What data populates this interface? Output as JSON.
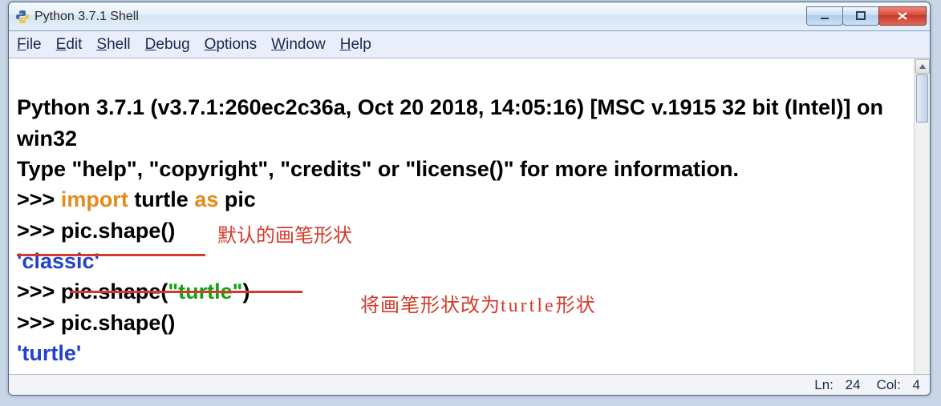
{
  "window": {
    "title": "Python 3.7.1 Shell"
  },
  "menu": {
    "file": "File",
    "edit": "Edit",
    "shell": "Shell",
    "debug": "Debug",
    "options": "Options",
    "window": "Window",
    "help": "Help"
  },
  "shell": {
    "banner1": "Python 3.7.1 (v3.7.1:260ec2c36a, Oct 20 2018, 14:05:16) [MSC v.1915 32 bit (Intel)] on win32",
    "banner2": "Type \"help\", \"copyright\", \"credits\" or \"license()\" for more information.",
    "prompt": ">>> ",
    "line1_kw_import": "import",
    "line1_mod": " turtle ",
    "line1_kw_as": "as",
    "line1_alias": " pic",
    "line2": "pic.shape()",
    "out1": "'classic'",
    "line3_pre": "pic.shape(",
    "line3_str": "\"turtle\"",
    "line3_post": ")",
    "line4": "pic.shape()",
    "out2": "'turtle'"
  },
  "annotations": {
    "a1": "默认的画笔形状",
    "a2_pre": "将画笔形状改为",
    "a2_mid": "turtle",
    "a2_post": "形状"
  },
  "status": {
    "ln_label": "Ln:",
    "ln_val": "24",
    "col_label": "Col:",
    "col_val": "4"
  }
}
